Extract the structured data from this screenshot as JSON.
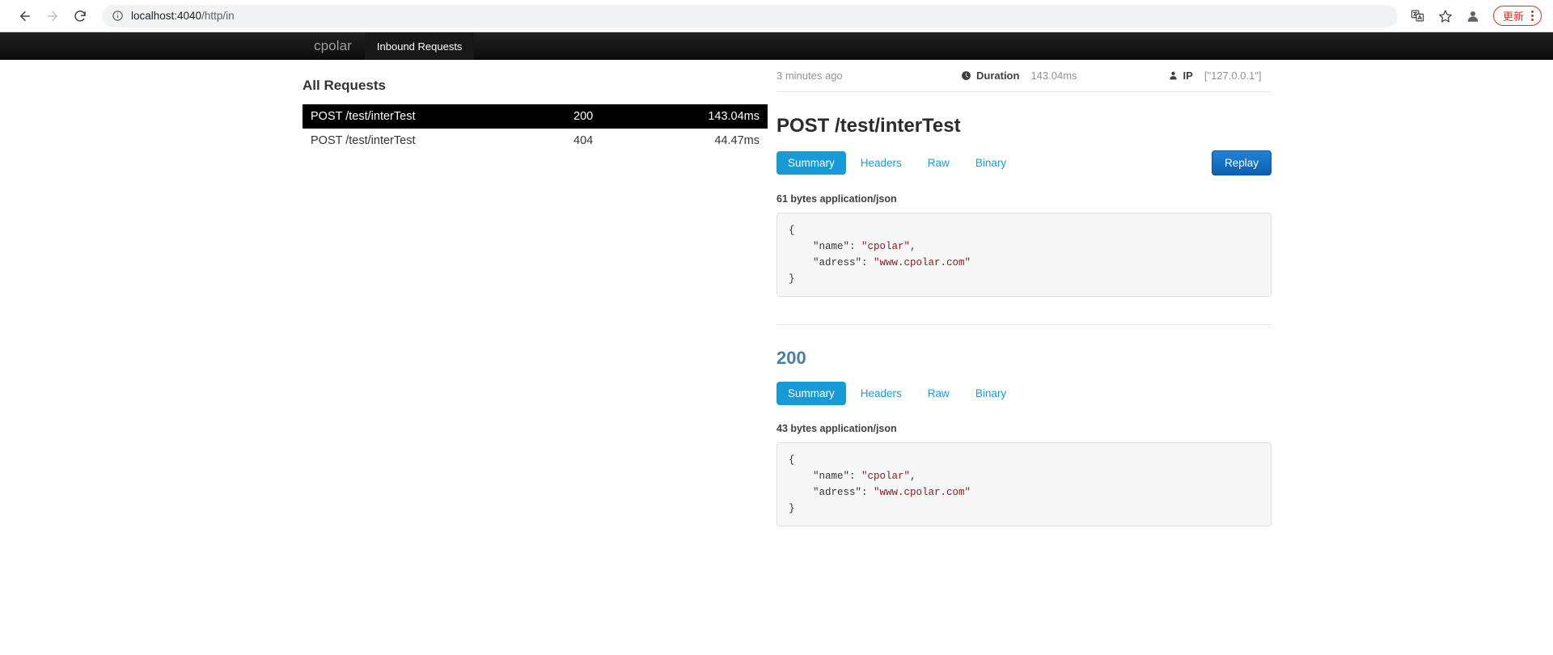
{
  "browser": {
    "back_icon": "back-arrow-icon",
    "forward_icon": "forward-arrow-icon",
    "reload_icon": "reload-icon",
    "info_icon": "site-info-icon",
    "url_host": "localhost:4040",
    "url_path": "/http/in",
    "url_full": "localhost:4040/http/in",
    "translate_icon": "translate-icon",
    "bookmark_icon": "star-icon",
    "profile_icon": "profile-avatar-icon",
    "update_label": "更新",
    "menu_icon": "three-dot-menu-icon"
  },
  "app_nav": {
    "brand": "cpolar",
    "tabs": [
      {
        "label": "Inbound Requests",
        "active": true
      }
    ]
  },
  "requests_panel": {
    "title": "All Requests",
    "rows": [
      {
        "name": "POST /test/interTest",
        "status": "200",
        "duration": "143.04ms",
        "selected": true
      },
      {
        "name": "POST /test/interTest",
        "status": "404",
        "duration": "44.47ms",
        "selected": false
      }
    ]
  },
  "detail": {
    "meta": {
      "time_ago": "3 minutes ago",
      "duration_icon": "clock-icon",
      "duration_label": "Duration",
      "duration_value": "143.04ms",
      "ip_icon": "person-icon",
      "ip_label": "IP",
      "ip_value": "[\"127.0.0.1\"]"
    },
    "request": {
      "title": "POST /test/interTest",
      "tabs": [
        {
          "label": "Summary",
          "active": true
        },
        {
          "label": "Headers",
          "active": false
        },
        {
          "label": "Raw",
          "active": false
        },
        {
          "label": "Binary",
          "active": false
        }
      ],
      "replay_label": "Replay",
      "bytes_line": "61 bytes application/json",
      "body": {
        "open_brace": "{",
        "line1_key": "    \"name\":",
        "line1_val": " \"cpolar\",",
        "line2_key": "    \"adress\":",
        "line2_val": " \"www.cpolar.com\"",
        "close_brace": "}"
      }
    },
    "response": {
      "title": "200",
      "tabs": [
        {
          "label": "Summary",
          "active": true
        },
        {
          "label": "Headers",
          "active": false
        },
        {
          "label": "Raw",
          "active": false
        },
        {
          "label": "Binary",
          "active": false
        }
      ],
      "bytes_line": "43 bytes application/json",
      "body": {
        "open_brace": "{",
        "line1_key": "    \"name\":",
        "line1_val": " \"cpolar\",",
        "line2_key": "    \"adress\":",
        "line2_val": " \"www.cpolar.com\"",
        "close_brace": "}"
      }
    }
  },
  "colors": {
    "accent_blue": "#189ad6",
    "replay_blue": "#1568b8",
    "update_red": "#d93025",
    "selected_row": "#000000",
    "json_string": "#8b1a1a"
  }
}
